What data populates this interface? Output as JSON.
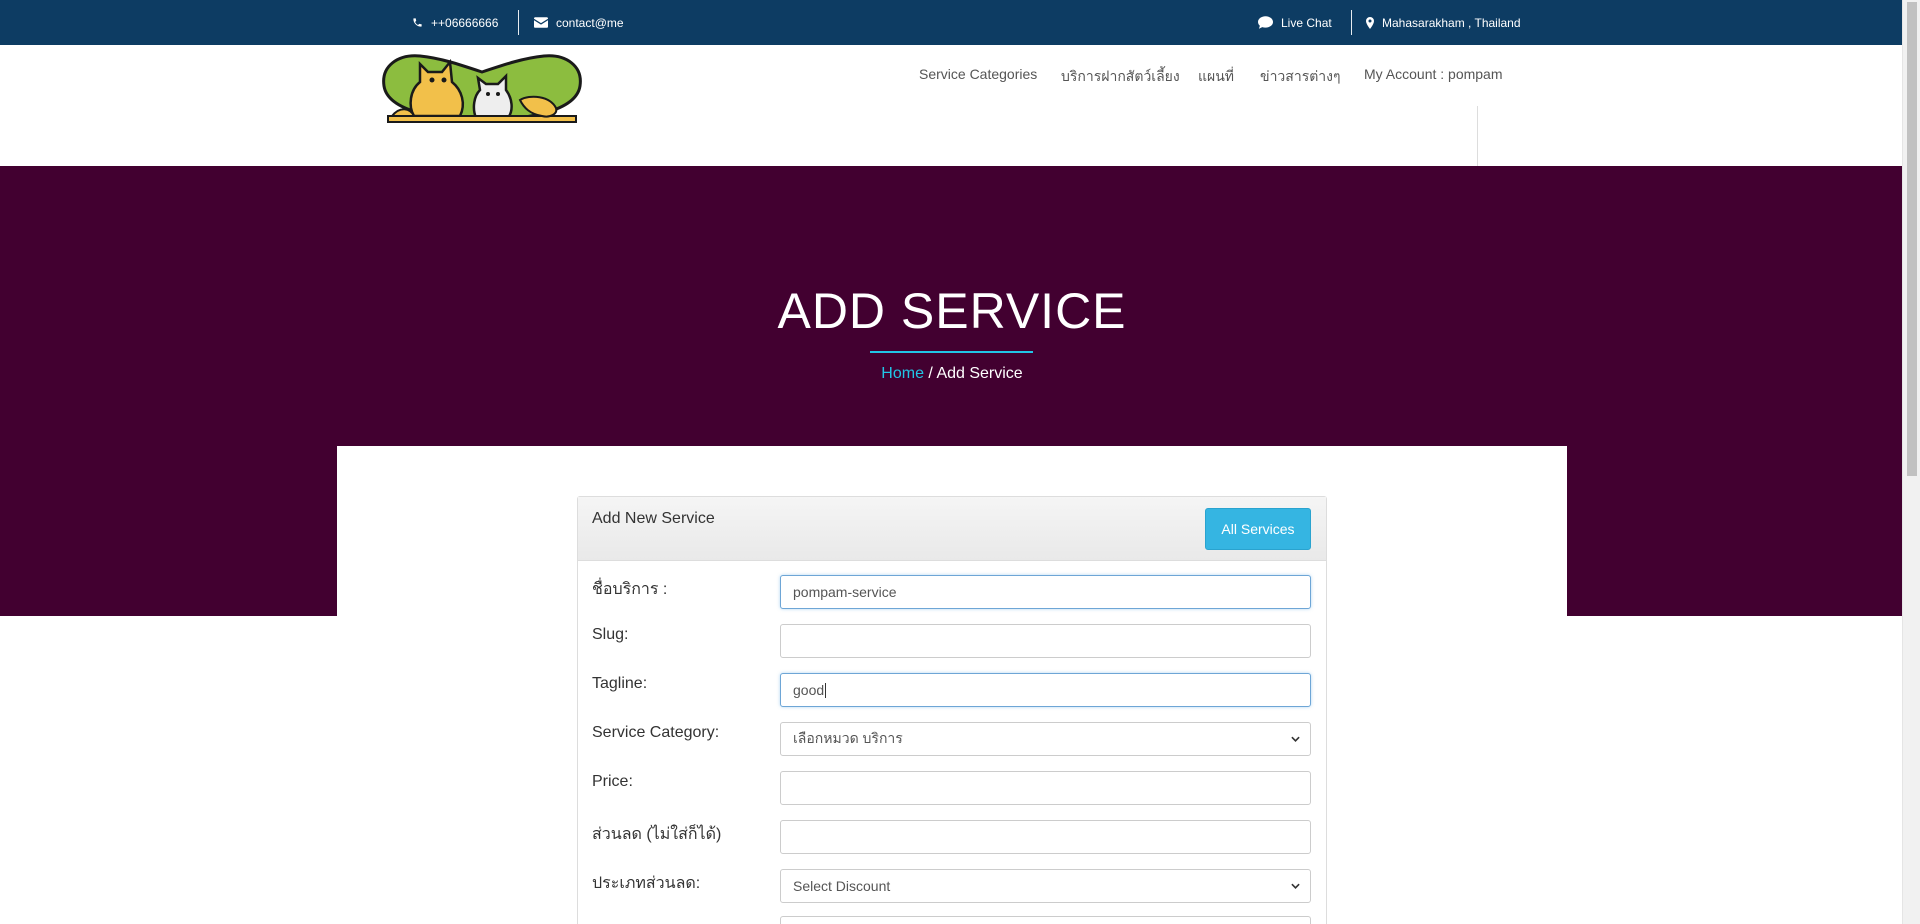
{
  "topbar": {
    "phone": "++06666666",
    "email": "contact@me",
    "live_chat": "Live Chat",
    "location": "Mahasarakham , Thailand"
  },
  "nav": {
    "items": [
      {
        "label": "Service Categories"
      },
      {
        "label": "บริการฝากสัตว์เลี้ยง"
      },
      {
        "label": "แผนที่"
      },
      {
        "label": "ข่าวสารต่างๆ"
      },
      {
        "label": "My Account : pompam"
      }
    ]
  },
  "banner": {
    "title": "ADD SERVICE",
    "breadcrumb_home": "Home",
    "breadcrumb_sep": "/",
    "breadcrumb_current": "Add Service"
  },
  "panel": {
    "title": "Add New Service",
    "all_services_label": "All Services"
  },
  "form": {
    "name": {
      "label": "ชื่อบริการ :",
      "value": "pompam-service"
    },
    "slug": {
      "label": "Slug:",
      "value": ""
    },
    "tagline": {
      "label": "Tagline:",
      "value": "good"
    },
    "category": {
      "label": "Service Category:",
      "selected": "เลือกหมวด บริการ"
    },
    "price": {
      "label": "Price:",
      "value": ""
    },
    "discount": {
      "label": "ส่วนลด (ไม่ใส่ก็ได้)",
      "value": ""
    },
    "discount_type": {
      "label": "ประเภทส่วนลด:",
      "selected": "Select Discount"
    }
  },
  "colors": {
    "topbar": "#0d3c63",
    "banner": "#420030",
    "accent": "#22c5e6",
    "button": "#35b5e2"
  }
}
